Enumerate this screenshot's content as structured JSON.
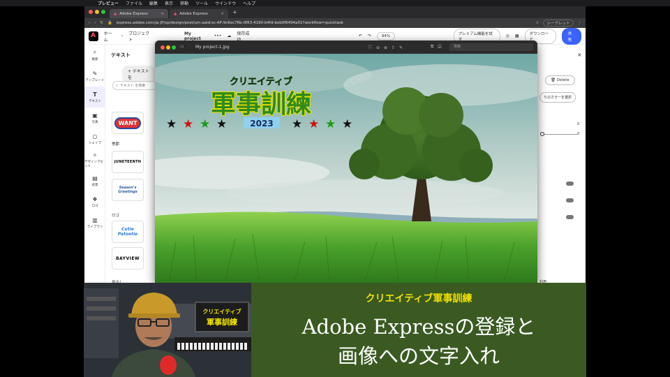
{
  "menubar": {
    "app": "プレビュー",
    "items": [
      "ファイル",
      "編集",
      "表示",
      "移動",
      "ツール",
      "ウインドウ",
      "ヘルプ"
    ]
  },
  "browser": {
    "tabs": [
      {
        "label": "Adobe Express"
      },
      {
        "label": "Adobe Express"
      }
    ],
    "url": "express.adobe.com/ja-JP/sp/design/post/urn:aaid:sc:AP:9c6ec76b-0f83-4190-b4fd-beb0f6494a01?workflow=quicktask",
    "secret_label": "シークレット"
  },
  "adobe_header": {
    "breadcrumb_home": "ホーム",
    "breadcrumb_projects": "プロジェクト",
    "project_name": "My project",
    "save_status": "保存成功",
    "zoom": "94%",
    "premium": "プレミアム機能を試す",
    "download": "ダウンロード",
    "share": "共有"
  },
  "rail": [
    {
      "label": "検索",
      "icon": "search-icon"
    },
    {
      "label": "テンプレート",
      "icon": "template-icon"
    },
    {
      "label": "テキスト",
      "icon": "text-icon"
    },
    {
      "label": "写真",
      "icon": "photo-icon"
    },
    {
      "label": "シェイプ",
      "icon": "shape-icon"
    },
    {
      "label": "デザインアセット",
      "icon": "assets-icon"
    },
    {
      "label": "背景",
      "icon": "background-icon"
    },
    {
      "label": "ロゴ",
      "icon": "logo-icon"
    },
    {
      "label": "ライブラリ",
      "icon": "library-icon"
    }
  ],
  "panel": {
    "title": "テキスト",
    "add_text": "+ テキストを",
    "search_placeholder": "テキスト を検索",
    "section_seasonal": "季節",
    "section_logo": "ロゴ",
    "section_headline": "見出し",
    "cards": {
      "want": "WANT",
      "juneteenth": "JUNETEENTH",
      "seasons": "Season's Greetings",
      "cutie": "Cutie Patootie",
      "bayview": "BAYVIEW"
    }
  },
  "rightpane": {
    "delete": "Delete",
    "color": "りのカラーを選択",
    "value1": "0",
    "value2": "0",
    "foot": "利用"
  },
  "preview": {
    "title": "My project-1.jpg",
    "search_placeholder": "検索",
    "image_texts": {
      "subtitle": "クリエイティブ",
      "title": "軍事訓練",
      "year": "2023"
    }
  },
  "banner": {
    "tag": "クリエイティブ軍事訓練",
    "line1": "Adobe Expressの登録と",
    "line2": "画像への文字入れ"
  },
  "webcam": {
    "sign_line1": "クリエイティブ",
    "sign_line2": "軍事訓練"
  }
}
